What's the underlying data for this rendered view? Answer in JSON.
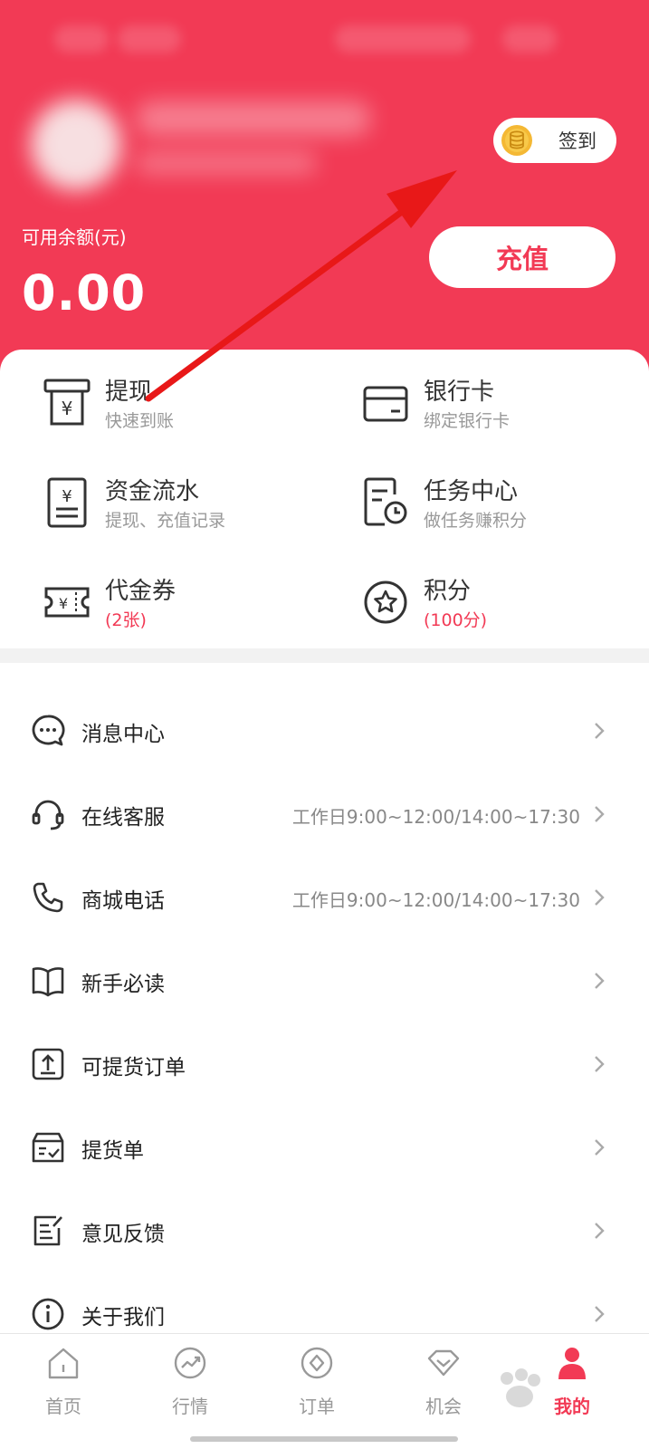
{
  "colors": {
    "brand": "#f23a55",
    "background": "#ffffff",
    "muted_text": "#999999",
    "coin": "#f4b834"
  },
  "header": {
    "checkin_label": "签到",
    "checkin_icon": "coin-stack-icon",
    "balance_label": "可用余额(元)",
    "balance_value": "0.00",
    "recharge_label": "充值"
  },
  "grid": [
    {
      "title": "提现",
      "subtitle": "快速到账",
      "icon": "atm-withdraw-icon"
    },
    {
      "title": "银行卡",
      "subtitle": "绑定银行卡",
      "icon": "bank-card-icon"
    },
    {
      "title": "资金流水",
      "subtitle": "提现、充值记录",
      "icon": "statement-icon"
    },
    {
      "title": "任务中心",
      "subtitle": "做任务赚积分",
      "icon": "task-clock-icon"
    },
    {
      "title": "代金券",
      "subtitle": "(2张)",
      "icon": "voucher-icon"
    },
    {
      "title": "积分",
      "subtitle": "(100分)",
      "icon": "star-points-icon"
    }
  ],
  "menu": [
    {
      "label": "消息中心",
      "extra": "",
      "icon": "message-bubble-icon"
    },
    {
      "label": "在线客服",
      "extra": "工作日9:00~12:00/14:00~17:30",
      "icon": "headset-icon"
    },
    {
      "label": "商城电话",
      "extra": "工作日9:00~12:00/14:00~17:30",
      "icon": "phone-icon"
    },
    {
      "label": "新手必读",
      "extra": "",
      "icon": "book-icon"
    },
    {
      "label": "可提货订单",
      "extra": "",
      "icon": "upload-box-icon"
    },
    {
      "label": "提货单",
      "extra": "",
      "icon": "delivery-box-icon"
    },
    {
      "label": "意见反馈",
      "extra": "",
      "icon": "feedback-edit-icon"
    },
    {
      "label": "关于我们",
      "extra": "",
      "icon": "info-icon"
    }
  ],
  "bottom_nav": [
    {
      "label": "首页",
      "icon": "home-icon",
      "active": false
    },
    {
      "label": "行情",
      "icon": "trend-icon",
      "active": false
    },
    {
      "label": "订单",
      "icon": "order-icon",
      "active": false
    },
    {
      "label": "机会",
      "icon": "diamond-icon",
      "active": false
    },
    {
      "label": "我的",
      "icon": "user-icon",
      "active": true
    }
  ]
}
